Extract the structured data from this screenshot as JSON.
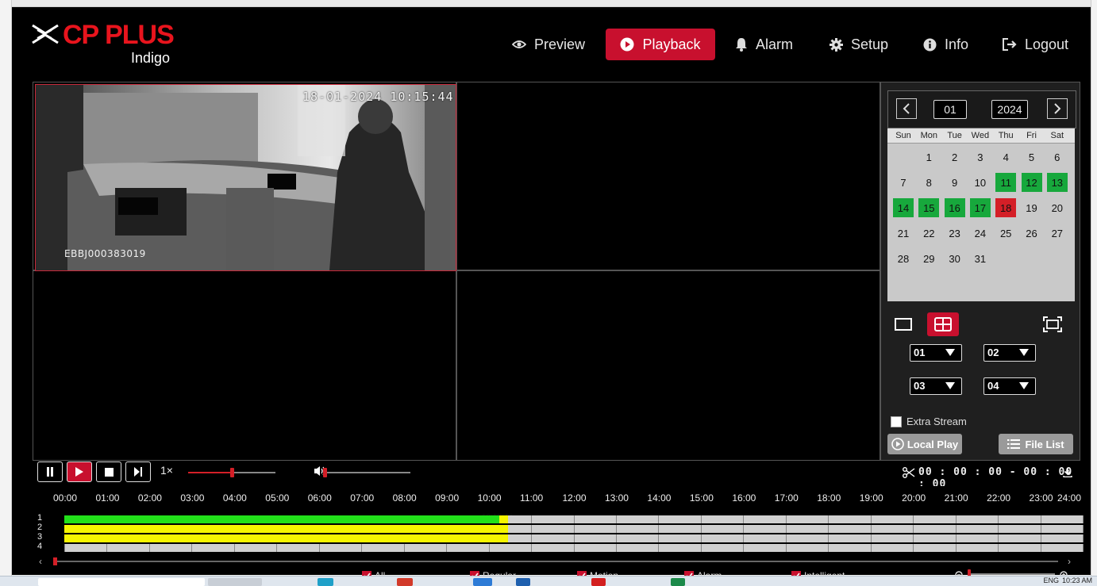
{
  "app": {
    "brand": "CP PLUS",
    "sub": "Indigo"
  },
  "nav": {
    "items": [
      {
        "label": "Preview",
        "icon": "eye-icon"
      },
      {
        "label": "Playback",
        "icon": "play-circle-icon",
        "active": true
      },
      {
        "label": "Alarm",
        "icon": "bell-icon"
      },
      {
        "label": "Setup",
        "icon": "gear-icon"
      },
      {
        "label": "Info",
        "icon": "info-icon"
      },
      {
        "label": "Logout",
        "icon": "logout-icon"
      }
    ]
  },
  "video": {
    "timestamp": "18-01-2024 10:15:44",
    "device_id": "EBBJ000383019"
  },
  "calendar": {
    "month": "01",
    "year": "2024",
    "weekdays": [
      "Sun",
      "Mon",
      "Tue",
      "Wed",
      "Thu",
      "Fri",
      "Sat"
    ],
    "days": [
      "1",
      "2",
      "3",
      "4",
      "5",
      "6",
      "7",
      "8",
      "9",
      "10",
      "11",
      "12",
      "13",
      "14",
      "15",
      "16",
      "17",
      "18",
      "19",
      "20",
      "21",
      "22",
      "23",
      "24",
      "25",
      "26",
      "27",
      "28",
      "29",
      "30",
      "31"
    ],
    "recorded_days": [
      11,
      12,
      13,
      14,
      15,
      16,
      17
    ],
    "selected_day": 18,
    "recorded_color": "#17a83c",
    "selected_color": "#d41f27"
  },
  "channels": {
    "sel1": "01",
    "sel2": "02",
    "sel3": "03",
    "sel4": "04"
  },
  "options": {
    "extra_stream": "Extra Stream",
    "local_play": "Local Play",
    "file_list": "File List"
  },
  "controls": {
    "speed": "1×",
    "progress": 0.5,
    "volume": 0.0,
    "time_range": "00 : 00 : 00 - 00 : 00 : 00"
  },
  "timeline": {
    "hours": [
      "00:00",
      "01:00",
      "02:00",
      "03:00",
      "04:00",
      "05:00",
      "06:00",
      "07:00",
      "08:00",
      "09:00",
      "10:00",
      "11:00",
      "12:00",
      "13:00",
      "14:00",
      "15:00",
      "16:00",
      "17:00",
      "18:00",
      "19:00",
      "20:00",
      "21:00",
      "22:00",
      "23:00",
      "24:00"
    ],
    "rows": [
      "1",
      "2",
      "3",
      "4"
    ],
    "cursor_time": "10:15:44",
    "recordings": [
      {
        "row": 1,
        "type": "regular",
        "start_hour": 0,
        "end_hour": 10.26
      },
      {
        "row": 1,
        "type": "motion",
        "start_hour": 10.26,
        "end_hour": 10.46
      },
      {
        "row": 2,
        "type": "motion",
        "start_hour": 0,
        "end_hour": 10.46
      },
      {
        "row": 3,
        "type": "motion",
        "start_hour": 0,
        "end_hour": 10.46
      }
    ],
    "colors": {
      "regular": "#22e01a",
      "motion": "#f6f600",
      "alarm": "#ff0000",
      "intelligent": "#b05cc8"
    }
  },
  "legend": {
    "all": "All",
    "regular": "Regular",
    "motion": "Motion",
    "alarm": "Alarm",
    "intelligent": "Intelligent"
  },
  "taskbar": {
    "lang": "ENG",
    "clock": "10:23 AM"
  }
}
